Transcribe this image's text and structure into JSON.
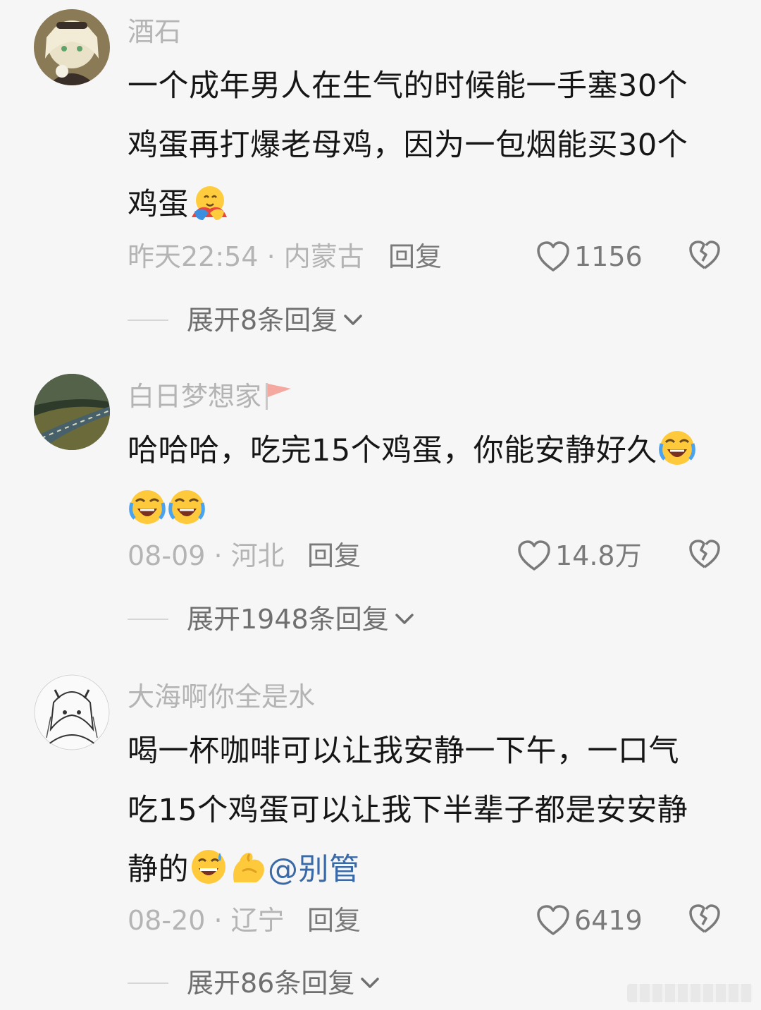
{
  "comments": [
    {
      "username": "酒石",
      "line1": "一个成年男人在生气的时候能一手塞30个",
      "line2": "鸡蛋再打爆老母鸡，因为一包烟能买30个",
      "line3": "鸡蛋",
      "emoji": "hugging-face",
      "time_location": "昨天22:54 · 内蒙古",
      "reply_label": "回复",
      "likes": "1156",
      "expand_label": "展开8条回复"
    },
    {
      "username": "白日梦想家",
      "username_emoji": "triangular-flag",
      "line1": "哈哈哈，吃完15个鸡蛋，你能安静好久",
      "emoji": "rolling-on-floor-laughing",
      "time_location": "08-09 · 河北",
      "reply_label": "回复",
      "likes": "14.8万",
      "expand_label": "展开1948条回复"
    },
    {
      "username": "大海啊你全是水",
      "line1": "喝一杯咖啡可以让我安静一下午，一口气",
      "line2": "吃15个鸡蛋可以让我下半辈子都是安安静",
      "line3": "静的",
      "emojis": [
        "grinning-sweat",
        "flexed-biceps"
      ],
      "mention": "@别管",
      "time_location": "08-20 · 辽宁",
      "reply_label": "回复",
      "likes": "6419",
      "expand_label": "展开86条回复"
    }
  ],
  "colors": {
    "background": "#f6f6f6",
    "username": "#b4b4b4",
    "body": "#161616",
    "meta": "#7a7a7a",
    "mention": "#3a69a8"
  }
}
